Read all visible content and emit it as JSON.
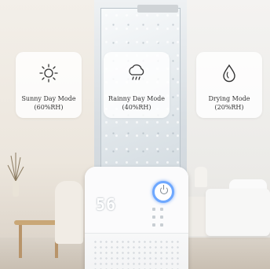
{
  "modes": [
    {
      "icon": "sun-icon",
      "label": "Sunny Day Mode",
      "sub": "(60%RH)"
    },
    {
      "icon": "rain-cloud-icon",
      "label": "Rainny Day Mode",
      "sub": "(40%RH)"
    },
    {
      "icon": "drop-icon",
      "label": "Drying Mode",
      "sub": "(20%RH)"
    }
  ],
  "device": {
    "display": "56"
  },
  "colors": {
    "accent": "#6ea8ff",
    "card_bg": "#ffffffd1"
  }
}
